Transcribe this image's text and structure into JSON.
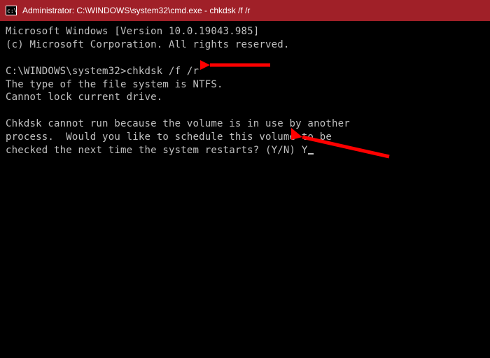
{
  "titlebar": {
    "title": "Administrator: C:\\WINDOWS\\system32\\cmd.exe - chkdsk  /f /r"
  },
  "terminal": {
    "header1": "Microsoft Windows [Version 10.0.19043.985]",
    "header2": "(c) Microsoft Corporation. All rights reserved.",
    "prompt": "C:\\WINDOWS\\system32>",
    "command": "chkdsk /f /r",
    "out1": "The type of the file system is NTFS.",
    "out2": "Cannot lock current drive.",
    "out3": "Chkdsk cannot run because the volume is in use by another",
    "out4": "process.  Would you like to schedule this volume to be",
    "out5_prefix": "checked the next time the system restarts? (Y/N) ",
    "user_input": "Y"
  },
  "annotation": {
    "arrow_color": "#ff0000"
  }
}
